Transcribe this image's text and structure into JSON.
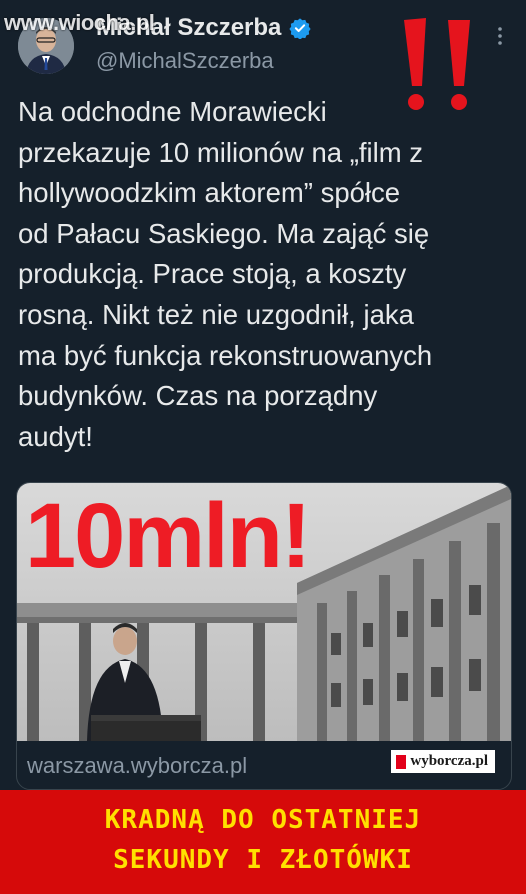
{
  "watermark": "www.wiocha.pl",
  "author": {
    "display_name": "Michał Szczerba",
    "handle": "@MichalSzczerba",
    "verified": true
  },
  "decoration": {
    "exclamation": "!!",
    "color": "#e5141d"
  },
  "menu_icon": "more-vertical-icon",
  "tweet": {
    "text": "Na odchodne Morawiecki\nprzekazuje 10 milionów na „film z\nhollywoodzkim aktorem” spółce\nod Pałacu Saskiego. Ma zająć się\nprodukcją. Prace stoją, a koszty\nrosną. Nikt też nie uzgodnił, jaka\nma być funkcja rekonstruowanych\nbudynków. Czas na porządny\naudyt!"
  },
  "link_card": {
    "headline": "10mln!",
    "source_logo": "wyborcza.pl",
    "domain": "warszawa.wyborcza.pl"
  },
  "banner": {
    "line1": "KRADNĄ DO OSTATNIEJ",
    "line2": "SEKUNDY I ZŁOTÓWKI",
    "background": "#d60a0a",
    "text_color": "#ffe000"
  }
}
